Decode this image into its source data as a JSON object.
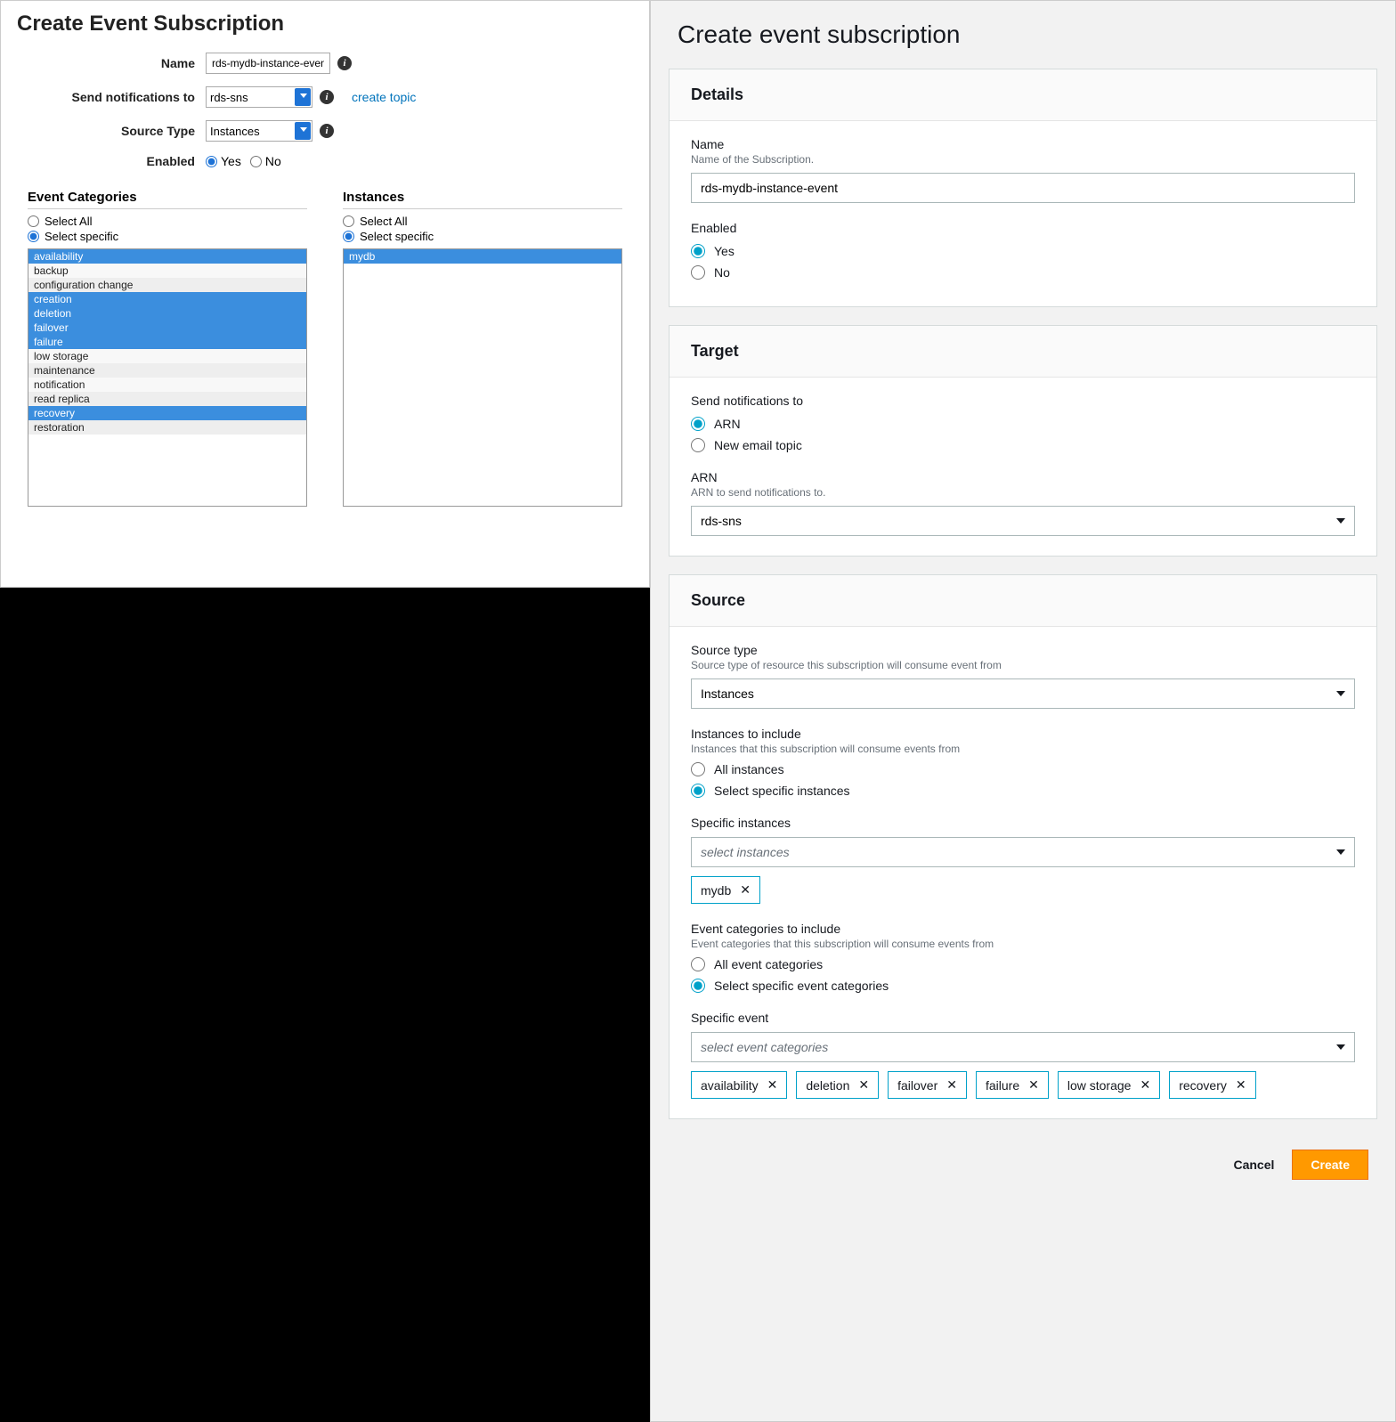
{
  "left": {
    "title": "Create Event Subscription",
    "labels": {
      "name": "Name",
      "send_to": "Send notifications to",
      "source_type": "Source Type",
      "enabled": "Enabled"
    },
    "name_value": "rds-mydb-instance-event",
    "send_to_value": "rds-sns",
    "create_topic": "create topic",
    "source_type_value": "Instances",
    "enabled_yes": "Yes",
    "enabled_no": "No",
    "event_categories_title": "Event Categories",
    "instances_title": "Instances",
    "select_all": "Select All",
    "select_specific": "Select specific",
    "categories": [
      {
        "label": "availability",
        "selected": true
      },
      {
        "label": "backup",
        "selected": false
      },
      {
        "label": "configuration change",
        "selected": false
      },
      {
        "label": "creation",
        "selected": true
      },
      {
        "label": "deletion",
        "selected": true
      },
      {
        "label": "failover",
        "selected": true
      },
      {
        "label": "failure",
        "selected": true
      },
      {
        "label": "low storage",
        "selected": false
      },
      {
        "label": "maintenance",
        "selected": false
      },
      {
        "label": "notification",
        "selected": false
      },
      {
        "label": "read replica",
        "selected": false
      },
      {
        "label": "recovery",
        "selected": true
      },
      {
        "label": "restoration",
        "selected": false
      }
    ],
    "instances": [
      {
        "label": "mydb",
        "selected": true
      }
    ]
  },
  "right": {
    "title": "Create event subscription",
    "details": {
      "header": "Details",
      "name_label": "Name",
      "name_help": "Name of the Subscription.",
      "name_value": "rds-mydb-instance-event",
      "enabled_label": "Enabled",
      "yes": "Yes",
      "no": "No"
    },
    "target": {
      "header": "Target",
      "send_label": "Send notifications to",
      "arn_opt": "ARN",
      "email_opt": "New email topic",
      "arn_label": "ARN",
      "arn_help": "ARN to send notifications to.",
      "arn_value": "rds-sns"
    },
    "source": {
      "header": "Source",
      "type_label": "Source type",
      "type_help": "Source type of resource this subscription will consume event from",
      "type_value": "Instances",
      "instances_label": "Instances to include",
      "instances_help": "Instances that this subscription will consume events from",
      "all_instances": "All instances",
      "specific_instances": "Select specific instances",
      "specific_inst_label": "Specific instances",
      "specific_inst_placeholder": "select instances",
      "instance_tags": [
        "mydb"
      ],
      "categories_label": "Event categories to include",
      "categories_help": "Event categories that this subscription will consume events from",
      "all_categories": "All event categories",
      "specific_categories": "Select specific event categories",
      "specific_event_label": "Specific event",
      "specific_event_placeholder": "select event categories",
      "category_tags": [
        "availability",
        "deletion",
        "failover",
        "failure",
        "low storage",
        "recovery"
      ]
    },
    "footer": {
      "cancel": "Cancel",
      "create": "Create"
    }
  }
}
